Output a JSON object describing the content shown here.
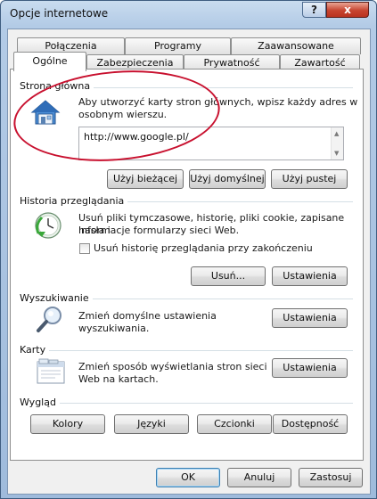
{
  "window": {
    "title": "Opcje internetowe",
    "help_glyph": "?",
    "close_glyph": "x"
  },
  "tabs": {
    "row1": [
      "Połączenia",
      "Programy",
      "Zaawansowane"
    ],
    "row2": [
      "Ogólne",
      "Zabezpieczenia",
      "Prywatność",
      "Zawartość"
    ],
    "active": "Ogólne"
  },
  "home": {
    "title": "Strona główna",
    "description": [
      "Aby utworzyć karty stron głównych, wpisz każdy adres w",
      "osobnym wierszu."
    ],
    "url": "http://www.google.pl/",
    "buttons": [
      "Użyj bieżącej",
      "Użyj domyślnej",
      "Użyj pustej"
    ],
    "icon": "house-icon"
  },
  "history": {
    "title": "Historia przeglądania",
    "description": [
      "Usuń pliki tymczasowe, historię, pliki cookie, zapisane hasła i",
      "informacje formularzy sieci Web."
    ],
    "checkbox_label": "Usuń historię przeglądania przy zakończeniu",
    "checkbox_checked": false,
    "delete_label": "Usuń...",
    "settings_label": "Ustawienia",
    "icon": "history-clock-icon"
  },
  "search": {
    "title": "Wyszukiwanie",
    "description": [
      "Zmień domyślne ustawienia",
      "wyszukiwania."
    ],
    "settings_label": "Ustawienia",
    "icon": "magnifier-icon"
  },
  "tabs_group": {
    "title": "Karty",
    "description": [
      "Zmień sposób wyświetlania stron sieci",
      "Web na kartach."
    ],
    "settings_label": "Ustawienia",
    "icon": "tabs-window-icon"
  },
  "appearance": {
    "title": "Wygląd",
    "buttons": [
      "Kolory",
      "Języki",
      "Czcionki",
      "Dostępność"
    ]
  },
  "footer": {
    "ok": "OK",
    "cancel": "Anuluj",
    "apply": "Zastosuj"
  },
  "colors": {
    "annotation_ellipse": "#c8102e",
    "close_button": "#c7442f"
  }
}
